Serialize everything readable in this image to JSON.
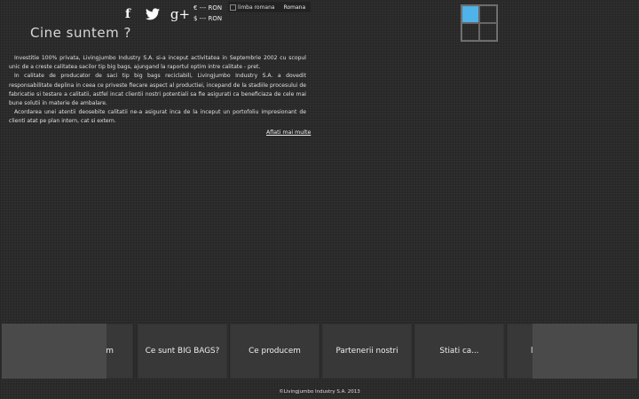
{
  "social": {
    "facebook": "f",
    "googleplus": "g+"
  },
  "currency": {
    "eur": "€ --- RON",
    "usd": "$ --- RON"
  },
  "language": {
    "flag_alt": "limba romana",
    "name": "Romana"
  },
  "about": {
    "title": "Cine suntem ?",
    "paragraphs": [
      "Investitie 100% privata, Livingjumbo Industry S.A. si-a inceput activitatea in Septembrie 2002 cu scopul unic de a creste calitatea sacilor tip big bags, ajungand la raportul optim intre calitate - pret.",
      "In calitate de producator de saci tip big bags reciclabili, Livingjumbo Industry S.A. a dovedit responsabilitate deplina in ceea ce priveste fiecare aspect al productiei, incepand de la stadiile procesului de fabricatie si testare a calitatii, astfel incat clientii nostri potentiali sa fie asigurati ca beneficiaza de cele mai bune solutii in materie de ambalare.",
      "Acordarea unei atentii deosebite calitatii ne-a asigurat inca de la inceput un portofoliu impresionant de clienti atat pe plan intern, cat si extern."
    ],
    "more_link": "Aflati mai multe"
  },
  "nav": {
    "items": [
      "m",
      "Ce sunt BIG BAGS?",
      "Ce producem",
      "Partenerii nostri",
      "Stiati ca...",
      "l"
    ]
  },
  "colors": {
    "accent": "#4fb2e8",
    "background": "#2b2b2b"
  },
  "footer": {
    "copyright": "©Livingjumbo Industry S.A. 2013"
  }
}
